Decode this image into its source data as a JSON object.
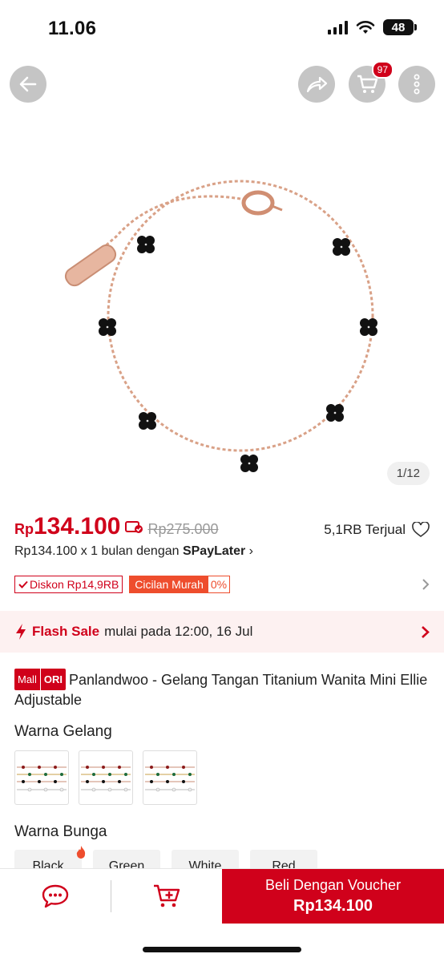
{
  "status_bar": {
    "time": "11.06",
    "battery": "48"
  },
  "header": {
    "cart_badge": "97"
  },
  "gallery": {
    "indicator": "1/12"
  },
  "price": {
    "currency": "Rp",
    "current": "134.100",
    "original": "Rp275.000",
    "sold": "5,1RB Terjual",
    "paylater_prefix": "Rp134.100 x 1 bulan dengan ",
    "paylater_brand": "SPayLater",
    "paylater_chevron": "›"
  },
  "promos": {
    "discount": "Diskon Rp14,9RB",
    "installment_label": "Cicilan Murah",
    "installment_rate": "0%"
  },
  "flash_sale": {
    "label": "Flash Sale",
    "text": "mulai pada 12:00, 16 Jul"
  },
  "product": {
    "badge_mall": "Mall",
    "badge_ori": "ORI",
    "title": "Panlandwoo - Gelang Tangan Titanium Wanita Mini Ellie Adjustable"
  },
  "variants": {
    "bracelet_label": "Warna Gelang",
    "flower_label": "Warna Bunga",
    "flower_options": [
      "Black",
      "Green",
      "White",
      "Red"
    ]
  },
  "bottom_bar": {
    "buy_label": "Beli Dengan Voucher",
    "buy_price": "Rp134.100"
  },
  "colors": {
    "brand": "#d0011b",
    "accent_orange": "#ee4d2d",
    "flash_bg": "#fdf1f1"
  }
}
